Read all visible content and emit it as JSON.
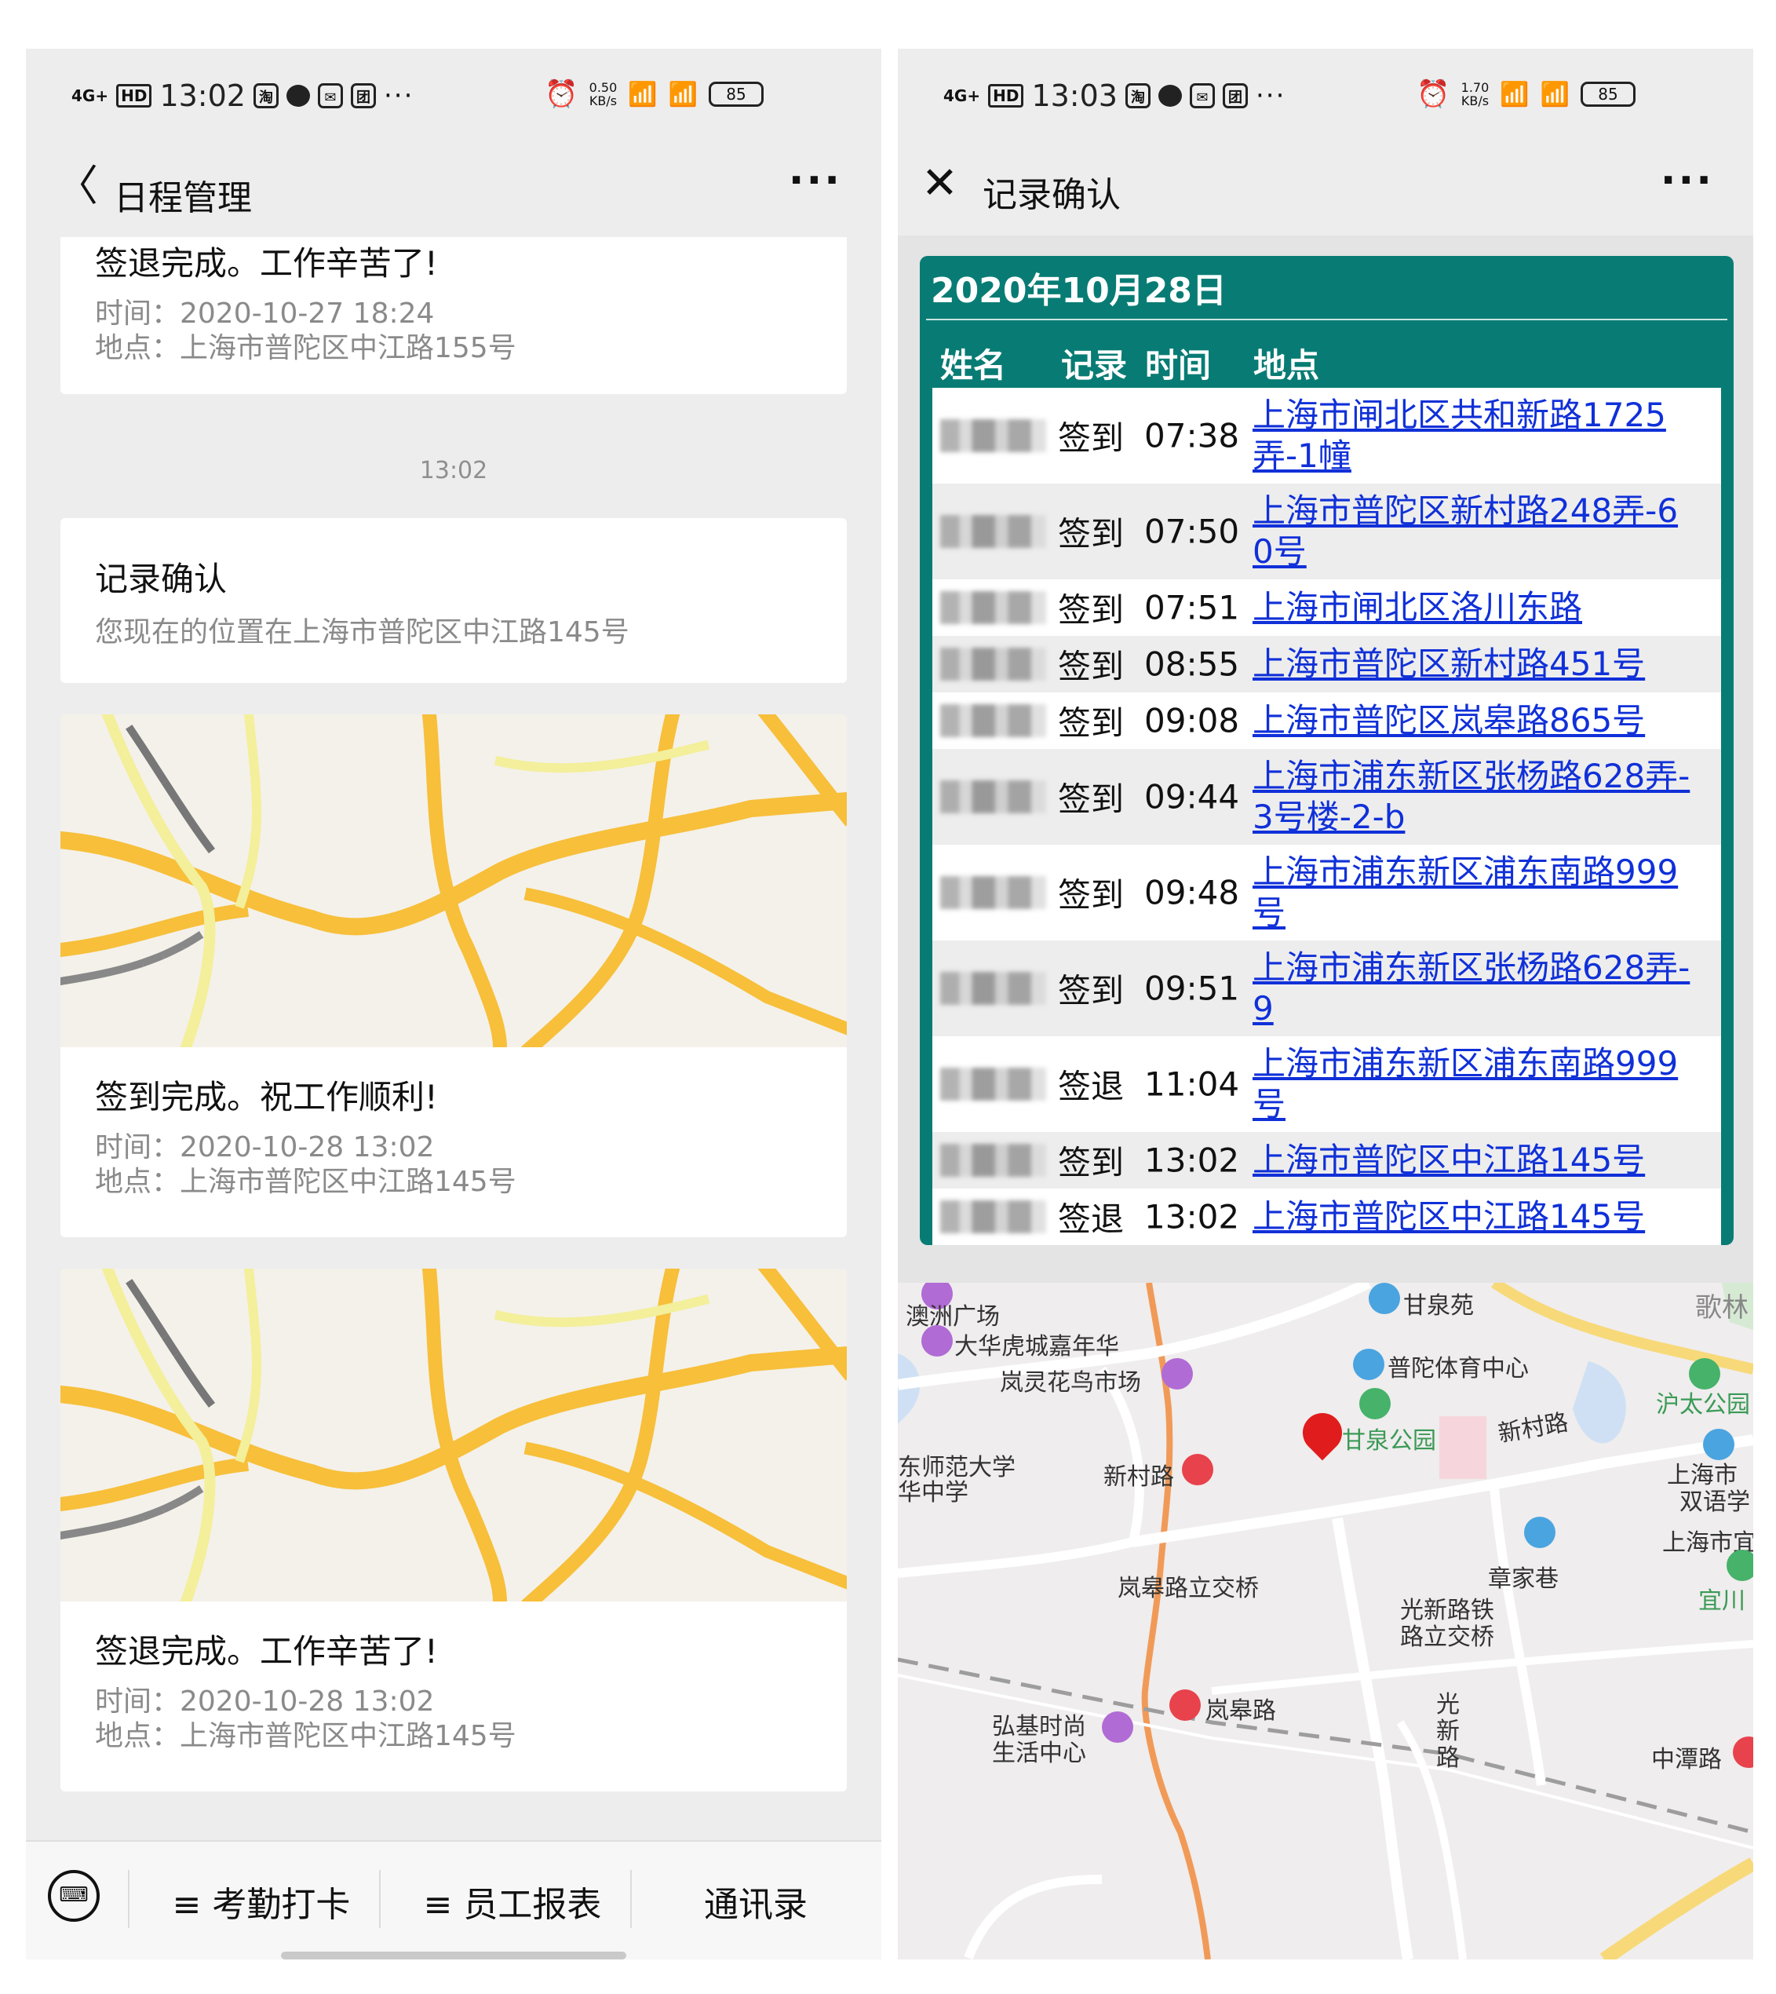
{
  "left_screen": {
    "status": {
      "net": "4G+",
      "hd": "HD",
      "time": "13:02",
      "speed_value": "0.50",
      "speed_unit": "KB/s",
      "battery": "85"
    },
    "title": "日程管理",
    "cards": [
      {
        "title": "签退完成。工作辛苦了!",
        "time_line": "时间：2020-10-27 18:24",
        "place_line": "地点：上海市普陀区中江路155号"
      },
      {
        "title": "记录确认",
        "subtitle": "您现在的位置在上海市普陀区中江路145号"
      },
      {
        "title": "签到完成。祝工作顺利!",
        "time_line": "时间：2020-10-28 13:02",
        "place_line": "地点：上海市普陀区中江路145号"
      },
      {
        "title": "签退完成。工作辛苦了!",
        "time_line": "时间：2020-10-28 13:02",
        "place_line": "地点：上海市普陀区中江路145号"
      }
    ],
    "timestamp": "13:02",
    "bottom_nav": {
      "item1": "≡ 考勤打卡",
      "item2": "≡ 员工报表",
      "item3": "通讯录"
    }
  },
  "right_screen": {
    "status": {
      "net": "4G+",
      "hd": "HD",
      "time": "13:03",
      "speed_value": "1.70",
      "speed_unit": "KB/s",
      "battery": "85"
    },
    "title": "记录确认",
    "record_table": {
      "date": "2020年10月28日",
      "headers": {
        "name": "姓名",
        "type": "记录",
        "time": "时间",
        "place": "地点"
      },
      "rows": [
        {
          "type": "签到",
          "time": "07:38",
          "place": "上海市闸北区共和新路1725弄-1幢"
        },
        {
          "type": "签到",
          "time": "07:50",
          "place": "上海市普陀区新村路248弄-60号"
        },
        {
          "type": "签到",
          "time": "07:51",
          "place": "上海市闸北区洛川东路"
        },
        {
          "type": "签到",
          "time": "08:55",
          "place": "上海市普陀区新村路451号"
        },
        {
          "type": "签到",
          "time": "09:08",
          "place": "上海市普陀区岚皋路865号"
        },
        {
          "type": "签到",
          "time": "09:44",
          "place": "上海市浦东新区张杨路628弄-3号楼-2-b"
        },
        {
          "type": "签到",
          "time": "09:48",
          "place": "上海市浦东新区浦东南路999号"
        },
        {
          "type": "签到",
          "time": "09:51",
          "place": "上海市浦东新区张杨路628弄-9"
        },
        {
          "type": "签退",
          "time": "11:04",
          "place": "上海市浦东新区浦东南路999号"
        },
        {
          "type": "签到",
          "time": "13:02",
          "place": "上海市普陀区中江路145号"
        },
        {
          "type": "签退",
          "time": "13:02",
          "place": "上海市普陀区中江路145号"
        }
      ]
    },
    "map_labels": {
      "l1": "澳洲广场",
      "l2": "大华虎城嘉年华",
      "l3": "岚灵花鸟市场",
      "l4": "甘泉苑",
      "l5": "歌林",
      "l6": "普陀体育中心",
      "l7": "沪太公园",
      "l8": "甘泉公园",
      "l9": "新村路",
      "l10": "新村路",
      "l11": "东师范大学",
      "l12": "华中学",
      "l13": "上海市",
      "l14": "双语学",
      "l15": "上海市宜",
      "l16": "章家巷",
      "l17": "宜川",
      "l18": "岚皋路立交桥",
      "l19": "光新路铁",
      "l20": "路立交桥",
      "l21": "岚皋路",
      "l22": "弘基时尚",
      "l23": "生活中心",
      "l24": "光",
      "l25": "新",
      "l26": "路",
      "l27": "中潭路"
    }
  },
  "colors": {
    "table_green": "#087c74",
    "link_blue": "#1030d8",
    "accent_orange": "#f5a623"
  }
}
